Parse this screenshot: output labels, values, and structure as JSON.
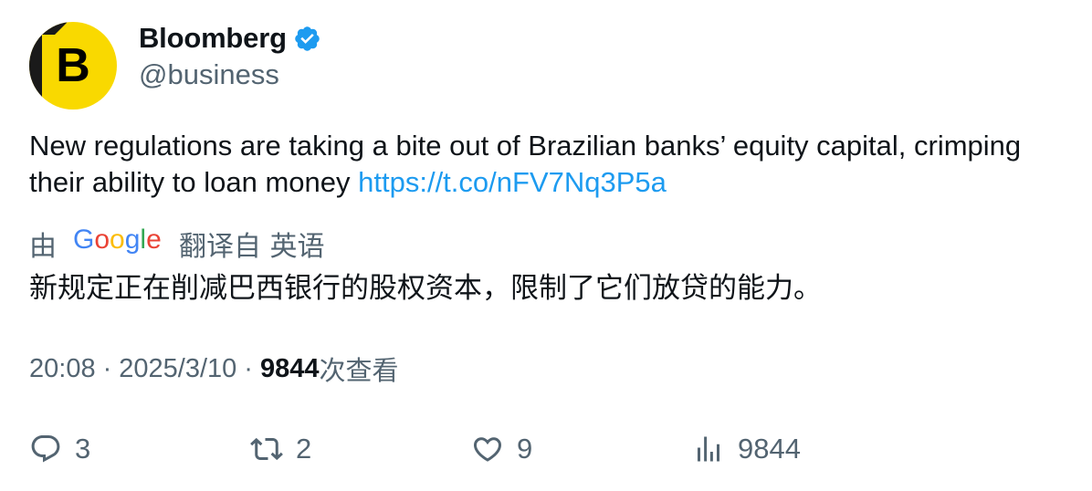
{
  "author": {
    "name": "Bloomberg",
    "handle": "@business",
    "avatar_letter": "B",
    "avatar_color": "#f9d900",
    "verified_color": "#1d9bf0"
  },
  "tweet": {
    "text": "New regulations are taking a bite out of Brazilian banks’ equity capital, crimping their ability to loan money ",
    "link": "https://t.co/nFV7Nq3P5a"
  },
  "translation": {
    "prefix": "由",
    "provider": "Google",
    "suffix": "翻译自 英语",
    "text": "新规定正在削减巴西银行的股权资本，限制了它们放贷的能力。"
  },
  "meta": {
    "time": "20:08",
    "separator": "·",
    "date": "2025/3/10",
    "views_count": "9844",
    "views_label": "次查看"
  },
  "actions": {
    "replies": "3",
    "retweets": "2",
    "likes": "9",
    "views": "9844"
  },
  "icons": {
    "reply": "reply-icon",
    "retweet": "retweet-icon",
    "like": "heart-icon",
    "views": "analytics-icon",
    "verified": "verified-badge-icon"
  }
}
